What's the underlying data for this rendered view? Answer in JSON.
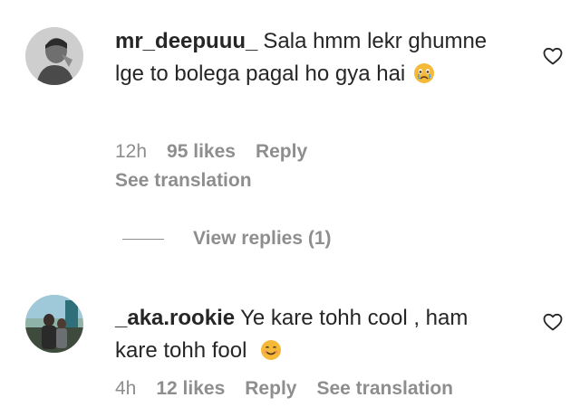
{
  "comments": [
    {
      "username": "mr_deepuuu_",
      "text": "Sala hmm lekr ghumne lge to bolega pagal ho gya hai",
      "emoji": "crying-face-emoji",
      "time": "12h",
      "likes": "95 likes",
      "reply_label": "Reply",
      "translation_label": "See translation",
      "view_replies_label": "View replies (1)"
    },
    {
      "username": "_aka.rookie",
      "text": "Ye kare tohh cool , ham kare tohh fool",
      "emoji": "smiling-face-emoji",
      "time": "4h",
      "likes": "12 likes",
      "reply_label": "Reply",
      "translation_label": "See translation"
    }
  ],
  "icons": {
    "like": "heart-outline-icon"
  },
  "colors": {
    "primary_text": "#262626",
    "secondary_text": "#8e8e8e",
    "background": "#ffffff"
  }
}
